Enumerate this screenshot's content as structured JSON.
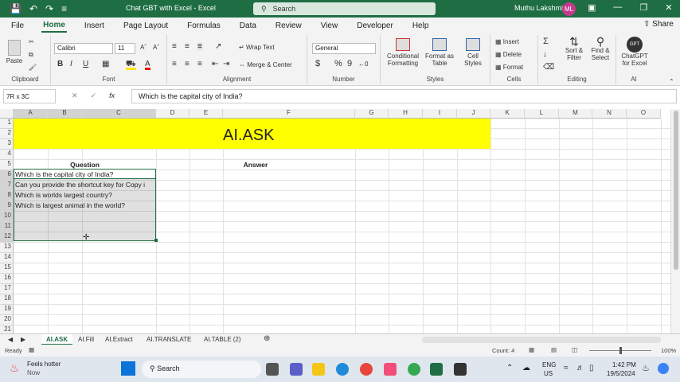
{
  "window": {
    "title": "Chat GBT with Excel  -  Excel",
    "search_placeholder": "Search",
    "user_name": "Muthu Lakshmi",
    "user_initials": "ML"
  },
  "menu": {
    "tabs": [
      "File",
      "Home",
      "Insert",
      "Page Layout",
      "Formulas",
      "Data",
      "Review",
      "View",
      "Developer",
      "Help"
    ],
    "active": "Home",
    "share": "Share"
  },
  "ribbon": {
    "clipboard": {
      "paste": "Paste",
      "label": "Clipboard"
    },
    "font": {
      "name": "Calibri",
      "size": "11",
      "bold": "B",
      "italic": "I",
      "underline": "U",
      "label": "Font"
    },
    "alignment": {
      "wrap": "Wrap Text",
      "merge": "Merge & Center",
      "label": "Alignment"
    },
    "number": {
      "format": "General",
      "currency": "$",
      "percent": "%",
      "comma": "9",
      "label": "Number"
    },
    "styles": {
      "conditional": "Conditional Formatting",
      "format_table": "Format as Table",
      "cell_styles": "Cell Styles",
      "label": "Styles"
    },
    "cells": {
      "insert": "Insert",
      "delete": "Delete",
      "format": "Format",
      "label": "Cells"
    },
    "editing": {
      "sort": "Sort & Filter",
      "find": "Find & Select",
      "label": "Editing"
    },
    "ai": {
      "gpt": "ChatGPT for Excel",
      "label": "AI",
      "badge": "GPT"
    }
  },
  "formula": {
    "namebox": "7R x 3C",
    "fx": "fx",
    "value": "Which is the capital city of India?"
  },
  "grid": {
    "columns": [
      "A",
      "B",
      "C",
      "D",
      "E",
      "F",
      "G",
      "H",
      "I",
      "J",
      "K",
      "L",
      "M",
      "N",
      "O"
    ],
    "rows": [
      "1",
      "2",
      "3",
      "4",
      "5",
      "6",
      "7",
      "8",
      "9",
      "10",
      "11",
      "12",
      "13",
      "14",
      "15",
      "16",
      "17",
      "18",
      "19",
      "20",
      "21"
    ],
    "banner": "AI.ASK",
    "banner_color": "#ffff00",
    "header_question": "Question",
    "header_answer": "Answer",
    "questions": [
      "Which is the capital city of India?",
      "Can you provide the shortcut key for Copy i",
      "Which is worlds largest country?",
      "Which is largest animal in the world?"
    ]
  },
  "sheets": {
    "tabs": [
      "AI.ASK",
      "AI.Fill",
      "AI.Extract",
      "AI.TRANSLATE",
      "AI.TABLE (2)"
    ],
    "active": "AI.ASK"
  },
  "status": {
    "ready": "Ready",
    "count": "Count: 4",
    "zoom": "100%"
  },
  "taskbar": {
    "weather_title": "Feels hotter",
    "weather_sub": "Now",
    "search": "Search",
    "lang1": "ENG",
    "lang2": "US",
    "time": "1:42 PM",
    "date": "19/5/2024"
  }
}
